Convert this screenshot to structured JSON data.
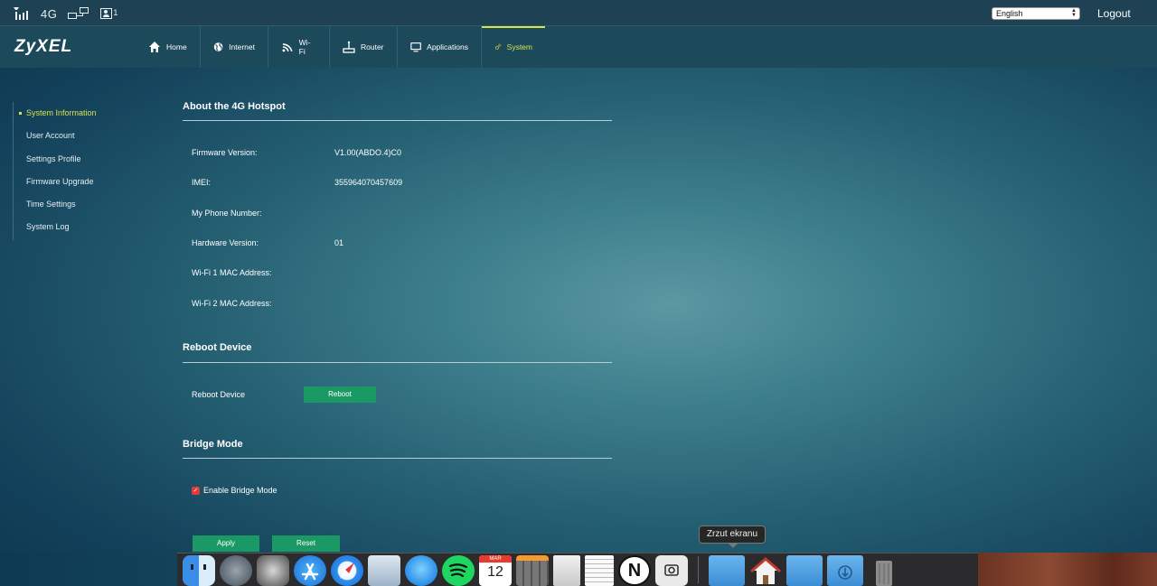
{
  "status_bar": {
    "network_type": "4G",
    "connected_users": "1",
    "language": "English",
    "logout_label": "Logout"
  },
  "header": {
    "logo": "ZyXEL",
    "nav": [
      {
        "label": "Home",
        "icon": "home-icon"
      },
      {
        "label": "Internet",
        "icon": "globe-icon"
      },
      {
        "label": "Wi-Fi",
        "icon": "wifi-icon"
      },
      {
        "label": "Router",
        "icon": "router-icon"
      },
      {
        "label": "Applications",
        "icon": "monitor-icon"
      },
      {
        "label": "System",
        "icon": "gear-icon",
        "active": true
      }
    ]
  },
  "sidebar": {
    "items": [
      {
        "label": "System Information",
        "active": true
      },
      {
        "label": "User Account"
      },
      {
        "label": "Settings Profile"
      },
      {
        "label": "Firmware Upgrade"
      },
      {
        "label": "Time Settings"
      },
      {
        "label": "System Log"
      }
    ]
  },
  "about": {
    "title": "About the 4G Hotspot",
    "fields": [
      {
        "label": "Firmware Version:",
        "value": "V1.00(ABDO.4)C0"
      },
      {
        "label": "IMEI:",
        "value": "355964070457609"
      },
      {
        "label": "My Phone Number:",
        "value": ""
      },
      {
        "label": "Hardware Version:",
        "value": "01"
      },
      {
        "label": "Wi-Fi 1 MAC Address:",
        "value": ""
      },
      {
        "label": "Wi-Fi 2 MAC Address:",
        "value": ""
      }
    ]
  },
  "reboot": {
    "title": "Reboot Device",
    "label": "Reboot Device",
    "button": "Reboot"
  },
  "bridge": {
    "title": "Bridge Mode",
    "checkbox_label": "Enable Bridge Mode",
    "checked": true
  },
  "actions": {
    "apply": "Apply",
    "reset": "Reset"
  },
  "dock": {
    "tooltip": "Zrzut ekranu",
    "calendar_month": "MAR",
    "calendar_day": "12",
    "apps": [
      "finder-icon",
      "launchpad-icon",
      "system-preferences-icon",
      "app-store-icon",
      "safari-icon",
      "mail-icon",
      "messages-icon",
      "spotify-icon",
      "calendar-icon",
      "calculator-icon",
      "preview-icon",
      "textedit-icon",
      "notion-icon",
      "screenshot-icon",
      "applications-folder-icon",
      "home-folder-icon",
      "documents-folder-icon",
      "downloads-folder-icon",
      "trash-icon"
    ],
    "colors": {
      "accent_green": "#1a9965",
      "active_yellow": "#d7e34b",
      "checkbox_red": "#e23a3a"
    }
  }
}
